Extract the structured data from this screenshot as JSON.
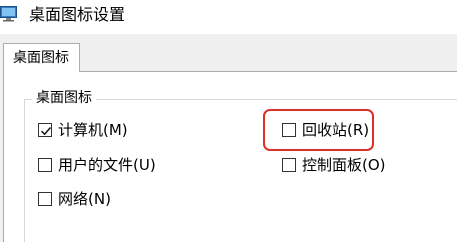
{
  "window": {
    "title": "桌面图标设置",
    "icon": "monitor-settings-icon"
  },
  "tabs": [
    {
      "label": "桌面图标",
      "selected": true
    }
  ],
  "group": {
    "label": "桌面图标"
  },
  "checkboxes": {
    "computer": {
      "label": "计算机(M)",
      "checked": true
    },
    "recycle_bin": {
      "label": "回收站(R)",
      "checked": false,
      "highlighted": true
    },
    "user_files": {
      "label": "用户的文件(U)",
      "checked": false
    },
    "control_panel": {
      "label": "控制面板(O)",
      "checked": false
    },
    "network": {
      "label": "网络(N)",
      "checked": false
    }
  },
  "colors": {
    "highlight": "#d9302a",
    "window_bg": "#f0f0f0",
    "panel_bg": "#ffffff"
  }
}
